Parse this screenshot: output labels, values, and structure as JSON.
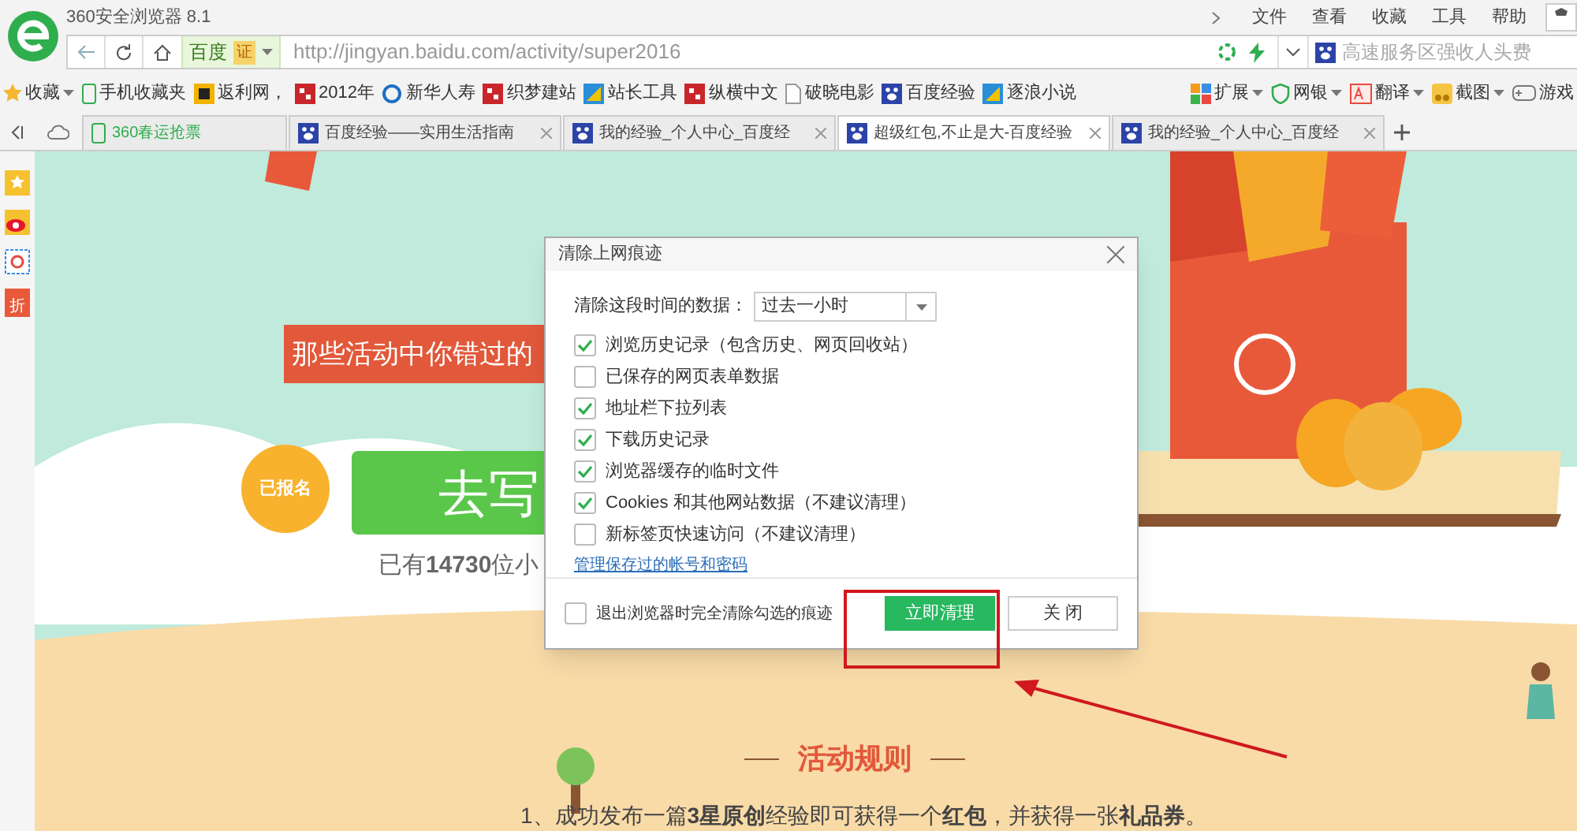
{
  "window": {
    "title": "360安全浏览器 8.1"
  },
  "menu": [
    "文件",
    "查看",
    "收藏",
    "工具",
    "帮助"
  ],
  "address_bar": {
    "site_badge": "百度",
    "cert": "证",
    "url": "http://jingyan.baidu.com/activity/super2016",
    "search_placeholder": "高速服务区强收人头费"
  },
  "bookmarks": [
    {
      "label": "收藏",
      "kind": "star"
    },
    {
      "label": "手机收藏夹",
      "kind": "phone"
    },
    {
      "label": "返利网，",
      "kind": "orange"
    },
    {
      "label": "2012年",
      "kind": "red"
    },
    {
      "label": "新华人寿",
      "kind": "ring"
    },
    {
      "label": "织梦建站",
      "kind": "red"
    },
    {
      "label": "站长工具",
      "kind": "blue"
    },
    {
      "label": "纵横中文",
      "kind": "red"
    },
    {
      "label": "破晓电影",
      "kind": "page"
    },
    {
      "label": "百度经验",
      "kind": "paw"
    },
    {
      "label": "逐浪小说",
      "kind": "blue"
    }
  ],
  "toolbar": [
    {
      "label": "扩展",
      "kind": "grid"
    },
    {
      "label": "网银",
      "kind": "shield"
    },
    {
      "label": "翻译",
      "kind": "translate"
    },
    {
      "label": "截图",
      "kind": "scissors"
    },
    {
      "label": "游戏",
      "kind": "game"
    }
  ],
  "tabs": [
    {
      "label": "360春运抢票",
      "selected": false,
      "kind": "phone"
    },
    {
      "label": "百度经验——实用生活指南",
      "selected": false,
      "kind": "paw"
    },
    {
      "label": "我的经验_个人中心_百度经",
      "selected": false,
      "kind": "paw"
    },
    {
      "label": "超级红包,不止是大-百度经验",
      "selected": true,
      "kind": "paw"
    },
    {
      "label": "我的经验_个人中心_百度经",
      "selected": false,
      "kind": "paw"
    }
  ],
  "sidebar": [
    {
      "kind": "star"
    },
    {
      "kind": "weibo"
    },
    {
      "kind": "mail"
    },
    {
      "kind": "discount",
      "label": "折"
    }
  ],
  "page": {
    "ribbon": "那些活动中你错过的",
    "signed_badge": "已报名",
    "write_button": "去写",
    "count_text": "已有**14730**位小",
    "rules_title": "活动规则",
    "rule": "1、成功发布一篇**3星原创**经验即可获得一个**红包**，并获得一张**礼品券**。"
  },
  "dialog": {
    "title": "清除上网痕迹",
    "range_label": "清除这段时间的数据：",
    "range_value": "过去一小时",
    "options": [
      {
        "label": "浏览历史记录（包含历史、网页回收站）",
        "checked": true
      },
      {
        "label": "已保存的网页表单数据",
        "checked": false
      },
      {
        "label": "地址栏下拉列表",
        "checked": true
      },
      {
        "label": "下载历史记录",
        "checked": true
      },
      {
        "label": "浏览器缓存的临时文件",
        "checked": true
      },
      {
        "label": "Cookies 和其他网站数据（不建议清理）",
        "checked": true
      },
      {
        "label": "新标签页快速访问（不建议清理）",
        "checked": false
      }
    ],
    "manage_link": "管理保存过的帐号和密码",
    "exit_option": {
      "label": "退出浏览器时完全清除勾选的痕迹",
      "checked": false
    },
    "buttons": [
      {
        "label": "立即清理",
        "kind": "primary"
      },
      {
        "label": "关 闭",
        "kind": "secondary"
      }
    ]
  }
}
